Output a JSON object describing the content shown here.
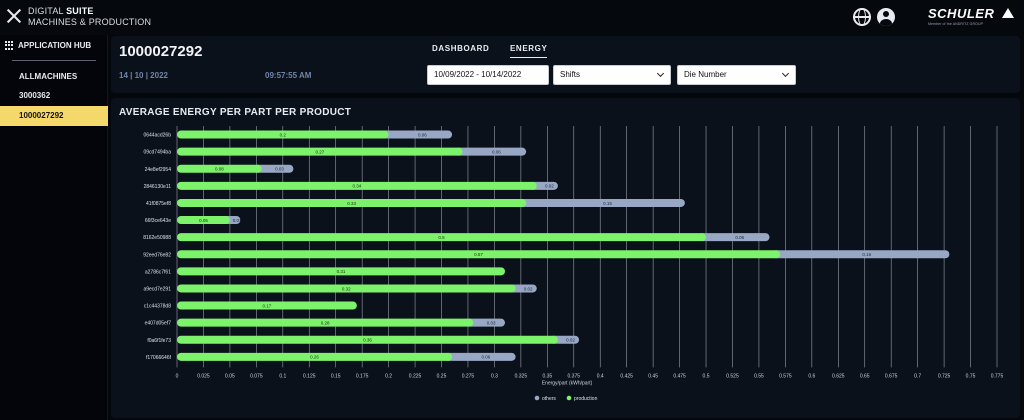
{
  "app": {
    "brand_line1_prefix": "DIGITAL ",
    "brand_line1_strong": "SUITE",
    "brand_line2": "MACHINES & PRODUCTION",
    "logo_text": "SCHULER",
    "logo_subtitle": "Member of the ANDRITZ GROUP"
  },
  "sidebar": {
    "hub_label": "APPLICATION HUB",
    "items": [
      {
        "label": "ALLMACHINES",
        "active": false
      },
      {
        "label": "3000362",
        "active": false
      },
      {
        "label": "1000027292",
        "active": true
      }
    ]
  },
  "header": {
    "machine_id": "1000027292",
    "date": "14 | 10 | 2022",
    "time": "09:57:55 AM",
    "tabs": [
      {
        "label": "DASHBOARD",
        "active": false
      },
      {
        "label": "ENERGY",
        "active": true
      }
    ],
    "date_range": "10/09/2022 - 10/14/2022",
    "shift_select": "Shifts",
    "die_select": "Die Number"
  },
  "panel": {
    "title": "AVERAGE ENERGY PER PART PER PRODUCT"
  },
  "colors": {
    "production": "#7cf36a",
    "others": "#98a8c4",
    "accent_yellow": "#f5d86a"
  },
  "chart_data": {
    "type": "bar",
    "orientation": "horizontal",
    "stacked": true,
    "categories": [
      "0644acd26b",
      "09cd7494ba",
      "24e8ef2954",
      "2846130e11",
      "41f0875ef8",
      "66f3ce643e",
      "8162e50988",
      "92eed76e82",
      "a2786c7f61",
      "a9ecd7e291",
      "c1c44378d8",
      "e407d05ef7",
      "f0a6f1fe73",
      "f17066646f"
    ],
    "series": [
      {
        "name": "production",
        "values": [
          0.2,
          0.27,
          0.08,
          0.34,
          0.33,
          0.05,
          0.5,
          0.57,
          0.31,
          0.32,
          0.17,
          0.28,
          0.36,
          0.26
        ]
      },
      {
        "name": "others",
        "values": [
          0.06,
          0.06,
          0.03,
          0.02,
          0.15,
          0.01,
          0.06,
          0.16,
          0.0,
          0.02,
          0.0,
          0.03,
          0.02,
          0.06
        ]
      }
    ],
    "value_labels": [
      [
        "0.2",
        "0.06"
      ],
      [
        "0.27",
        "0.06"
      ],
      [
        "0.08",
        "0.03"
      ],
      [
        "0.34",
        "0.02"
      ],
      [
        "0.33",
        "0.15"
      ],
      [
        "0.05",
        "0.01"
      ],
      [
        "0.5",
        "0.06"
      ],
      [
        "0.57",
        "0.16"
      ],
      [
        "0.31",
        ""
      ],
      [
        "0.32",
        "0.02"
      ],
      [
        "0.17",
        ""
      ],
      [
        "0.28",
        "0.03"
      ],
      [
        "0.36",
        "0.02"
      ],
      [
        "0.26",
        "0.06"
      ]
    ],
    "xlabel": "Energy/part (kWh/part)",
    "ylabel": "",
    "xlim": [
      0,
      0.775
    ],
    "xticks": [
      "0",
      "0.025",
      "0.05",
      "0.075",
      "0.1",
      "0.125",
      "0.15",
      "0.175",
      "0.2",
      "0.225",
      "0.25",
      "0.275",
      "0.3",
      "0.325",
      "0.35",
      "0.375",
      "0.4",
      "0.425",
      "0.45",
      "0.475",
      "0.5",
      "0.525",
      "0.55",
      "0.575",
      "0.6",
      "0.625",
      "0.65",
      "0.675",
      "0.7",
      "0.725",
      "0.75",
      "0.775"
    ],
    "legend": [
      "others",
      "production"
    ],
    "legend_position": "bottom-center",
    "grid": true
  }
}
